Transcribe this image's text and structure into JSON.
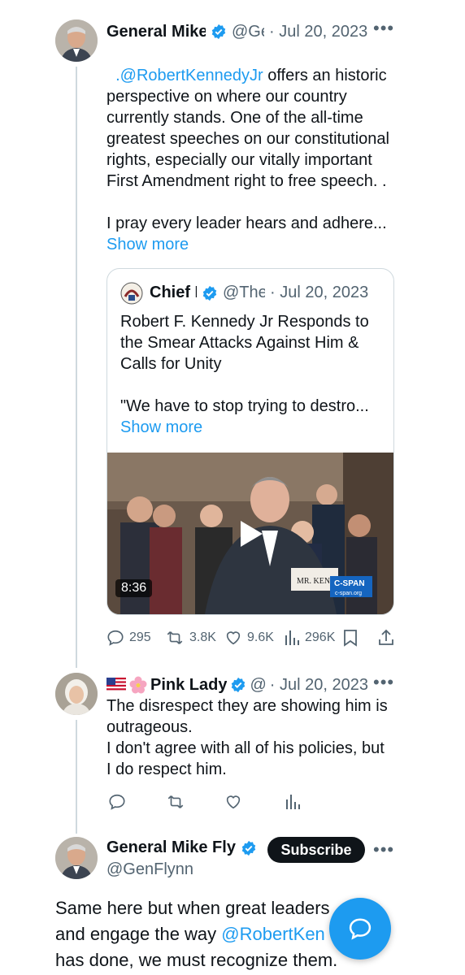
{
  "colors": {
    "accent": "#1d9bf0",
    "text": "#0f1419",
    "muted": "#536471",
    "border": "#cfd9de"
  },
  "tweet1": {
    "author_name": "General Mike",
    "handle": "@Ge",
    "date": "· Jul 20, 2023",
    "mention": ".@RobertKennedyJr",
    "text_rest": " offers an historic perspective on where our country currently stands. One of the all-time greatest speeches on our constitutional rights, especially our vitally important First Amendment right to free speech. .",
    "text_second": "I pray every leader hears and adhere...",
    "show_more": "Show more",
    "quote": {
      "author_name": "Chief N",
      "handle": "@TheC",
      "date": "· Jul 20, 2023",
      "text": "Robert F. Kennedy Jr Responds to the Smear Attacks Against Him & Calls for Unity",
      "text_second": "\"We have to stop trying to destro...",
      "show_more": "Show more",
      "video_duration": "8:36",
      "nameplate": "MR. KEN",
      "network": "C-SPAN",
      "network_url": "c-span.org"
    },
    "stats": {
      "replies": "295",
      "retweets": "3.8K",
      "likes": "9.6K",
      "views": "296K"
    }
  },
  "tweet2": {
    "author_name": "Pink Lady",
    "handle": "@",
    "date": "· Jul 20, 2023",
    "text": "The disrespect they are showing him is outrageous.\nI don't agree with all of his policies, but I do respect him."
  },
  "tweet3": {
    "author_name": "General Mike Fly",
    "handle": "@GenFlynn",
    "subscribe": "Subscribe",
    "text_a": "Same here but when great leaders",
    "text_b": "and engage the way ",
    "mention": "@RobertKen",
    "text_c": "has done, we must recognize them."
  },
  "icons": [
    "verified-badge-icon",
    "more-options-icon",
    "reply-icon",
    "retweet-icon",
    "like-icon",
    "views-icon",
    "bookmark-icon",
    "share-icon",
    "play-icon",
    "compose-icon",
    "us-flag-icon",
    "flower-icon"
  ]
}
